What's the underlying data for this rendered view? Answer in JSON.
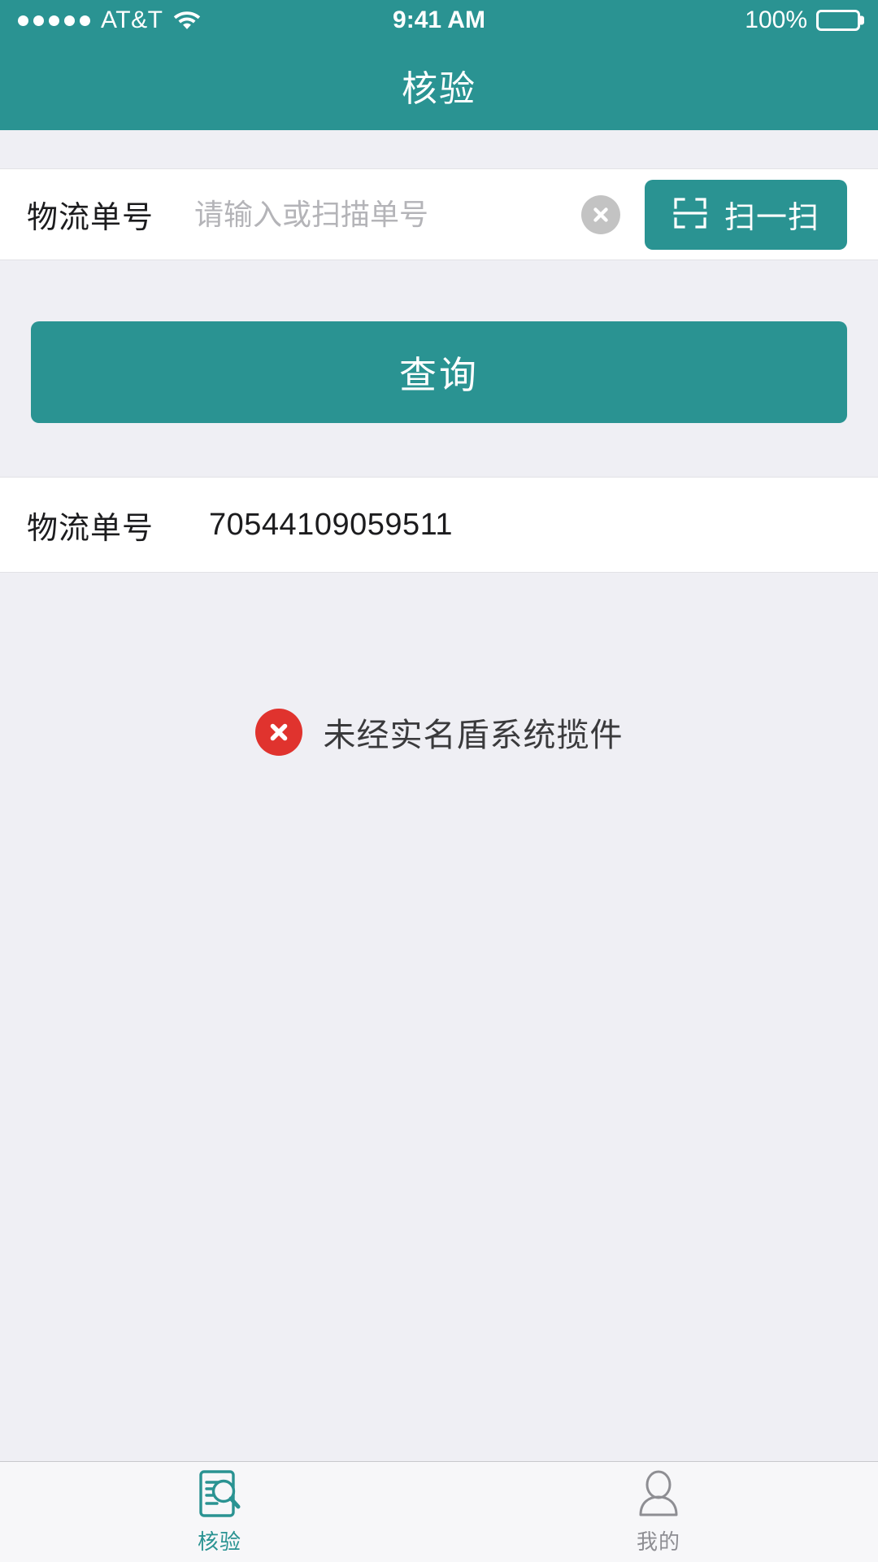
{
  "status_bar": {
    "carrier": "AT&T",
    "signal_dots": 5,
    "wifi_icon": "wifi-icon",
    "time": "9:41 AM",
    "battery_percent": "100%",
    "battery_icon": "battery-full-icon"
  },
  "nav": {
    "title": "核验"
  },
  "colors": {
    "accent_teal": "#2A9392",
    "page_background": "#EFEFF4",
    "card_white": "#FFFFFF",
    "error_red": "#E0332E",
    "inactive_gray": "#8E8E93",
    "placeholder_gray": "#B4B4B8",
    "clear_button_gray": "#C3C3C3"
  },
  "form": {
    "label": "物流单号",
    "input_value": "",
    "placeholder": "请输入或扫描单号",
    "clear_icon": "clear-circle-x-icon",
    "scan_button": {
      "label": "扫一扫",
      "icon": "scan-frame-icon"
    },
    "submit_button": {
      "label": "查询"
    }
  },
  "result": {
    "label": "物流单号",
    "value": "70544109059511"
  },
  "status_message": {
    "icon": "error-circle-x-icon",
    "text": "未经实名盾系统揽件"
  },
  "tab_bar": {
    "items": [
      {
        "label": "核验",
        "icon": "document-magnifier-icon",
        "active": true
      },
      {
        "label": "我的",
        "icon": "person-icon",
        "active": false
      }
    ]
  }
}
